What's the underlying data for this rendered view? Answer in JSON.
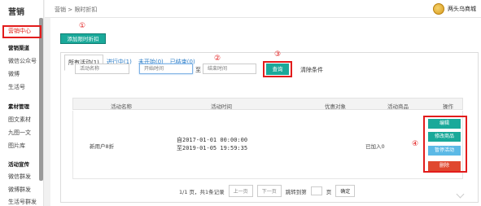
{
  "sidebar": {
    "title": "营销",
    "items": [
      {
        "label": "营销中心",
        "active": true
      },
      {
        "label": "营销渠道",
        "group": true
      },
      {
        "label": "微信公众号"
      },
      {
        "label": "微博"
      },
      {
        "label": "生活号"
      },
      {
        "label": "素材管理",
        "group": true
      },
      {
        "label": "图文素材"
      },
      {
        "label": "九图一文"
      },
      {
        "label": "图片库"
      },
      {
        "label": "活动宣传",
        "group": true
      },
      {
        "label": "微信群发"
      },
      {
        "label": "微博群发"
      },
      {
        "label": "生活号群发"
      }
    ]
  },
  "header": {
    "breadcrumb": "营销 > 限时折扣",
    "shop_name": "两头乌商城"
  },
  "annotations": {
    "n1": "①",
    "n2": "②",
    "n3": "③",
    "n4": "④"
  },
  "toolbar": {
    "add_label": "添加限时折扣"
  },
  "tabs": [
    "所有活动(1)",
    "进行中(1)",
    "未开始(0)",
    "已结束(0)"
  ],
  "filters": {
    "name_placeholder": "活动名称",
    "start_placeholder": "开始时间",
    "to_label": "至",
    "end_placeholder": "结束时间",
    "query_label": "查询",
    "clear_label": "清除条件"
  },
  "table": {
    "headers": [
      "活动名称",
      "活动时间",
      "优惠对象",
      "活动商品",
      "操作"
    ],
    "row": {
      "name": "新用户8折",
      "time_start": "自2017-01-01 00:00:00",
      "time_end": "至2019-01-05 19:59:35",
      "target": "",
      "goods": "已加入0",
      "actions": [
        "编辑",
        "修改商品",
        "暂停活动",
        "删除"
      ]
    }
  },
  "pager": {
    "info": "1/1 页，共1条记录",
    "prev": "上一页",
    "next": "下一页",
    "jump_label": "跳转到第",
    "page_unit": "页",
    "confirm": "确定"
  },
  "colors": {
    "accent": "#1aa99a",
    "highlight": "#e21c1c",
    "pause": "#5bb9e6",
    "delete": "#e0482f"
  }
}
